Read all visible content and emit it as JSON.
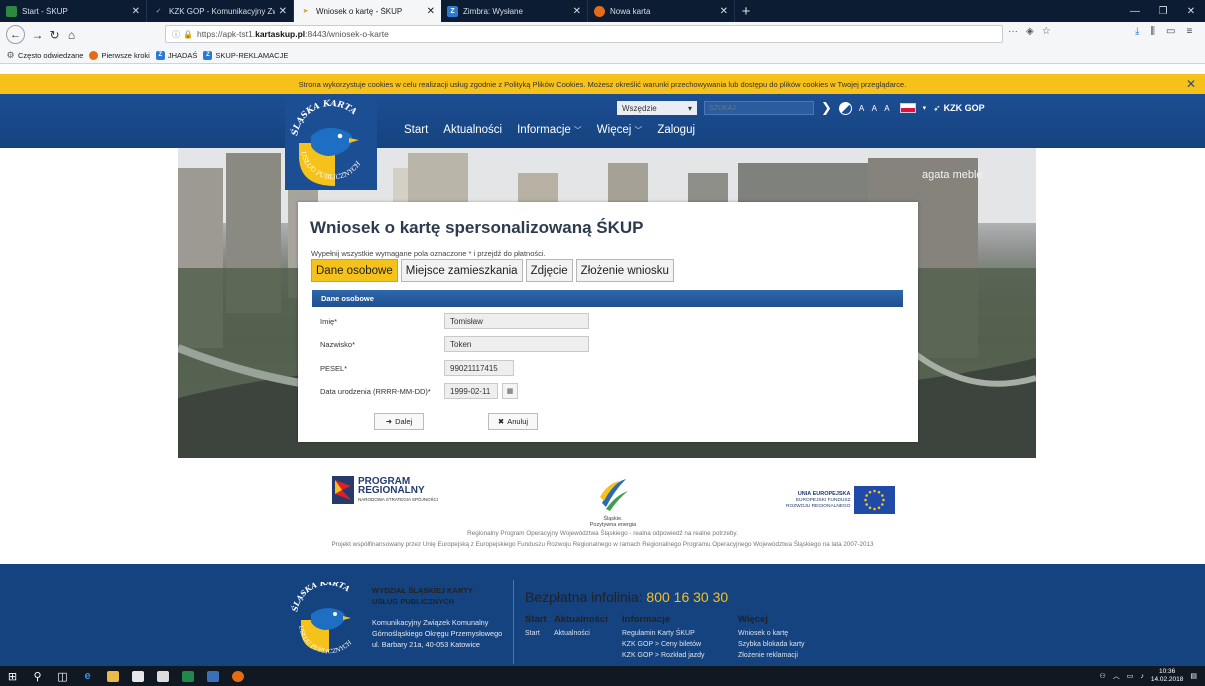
{
  "browser": {
    "tabs": [
      {
        "title": "Start - ŚKUP",
        "active": false
      },
      {
        "title": "KZK GOP - Komunikacyjny Zwi",
        "active": false
      },
      {
        "title": "Wniosek o kartę - ŚKUP",
        "active": true
      },
      {
        "title": "Zimbra: Wysłane",
        "active": false
      },
      {
        "title": "Nowa karta",
        "active": false
      }
    ],
    "url_prefix": "https://apk-tst1.",
    "url_host": "kartaskup.pl",
    "url_suffix": ":8443/wniosek-o-karte",
    "bookmarks": [
      "Często odwiedzane",
      "Pierwsze kroki",
      "JHADAŚ",
      "SKUP-REKLAMACJE"
    ]
  },
  "cookie_bar": {
    "text": "Strona wykorzystuje cookies w celu realizacji usług zgodnie z Polityką Plików Cookies. Możesz określić warunki przechowywania lub dostępu do plików cookies w Twojej przeglądarce."
  },
  "header": {
    "logo_top": "ŚLĄSKA KARTA",
    "logo_bottom": "USŁUG PUBLICZNYCH",
    "nav": [
      {
        "label": "Start",
        "dropdown": false
      },
      {
        "label": "Aktualności",
        "dropdown": false
      },
      {
        "label": "Informacje",
        "dropdown": true
      },
      {
        "label": "Więcej",
        "dropdown": true
      },
      {
        "label": "Zaloguj",
        "dropdown": false
      }
    ],
    "search_scope": "Wszędzie",
    "search_placeholder": "SZUKAJ",
    "font_sizes": "A A A",
    "kzk_label": "KZK GOP"
  },
  "hero": {
    "sign_text": "agata meble"
  },
  "form": {
    "title": "Wniosek o kartę spersonalizowaną ŚKUP",
    "hint": "Wypełnij wszystkie wymagane pola oznaczone * i przejdź do płatności.",
    "tabs": [
      {
        "label": "Dane osobowe",
        "active": true
      },
      {
        "label": "Miejsce zamieszkania",
        "active": false
      },
      {
        "label": "Zdjęcie",
        "active": false
      },
      {
        "label": "Złożenie wniosku",
        "active": false
      }
    ],
    "section_title": "Dane osobowe",
    "fields": {
      "first_name": {
        "label": "Imię*",
        "value": "Tomisław"
      },
      "last_name": {
        "label": "Nazwisko*",
        "value": "Token"
      },
      "pesel": {
        "label": "PESEL*",
        "value": "99021117415"
      },
      "birth_date": {
        "label": "Data urodzenia (RRRR-MM-DD)*",
        "value": "1999-02-11"
      }
    },
    "next_label": "Dalej",
    "cancel_label": "Anuluj"
  },
  "sponsors": {
    "program_line1": "PROGRAM",
    "program_line2": "REGIONALNY",
    "program_sub": "NARODOWA STRATEGIA SPÓJNOŚCI",
    "slaskie_line1": "Śląskie.",
    "slaskie_line2": "Pozytywna energia",
    "eu_line1": "UNIA EUROPEJSKA",
    "eu_line2": "EUROPEJSKI FUNDUSZ",
    "eu_line3": "ROZWOJU REGIONALNEGO",
    "line1": "Regionalny Program Operacyjny Województwa Śląskiego - realna odpowiedź na realne potrzeby.",
    "line2": "Projekt współfinansowany przez Unię Europejską z Europejskiego Funduszu Rozwoju Regionalnego w ramach Regionalnego Programu Operacyjnego Województwa Śląskiego na lata 2007-2013"
  },
  "footer": {
    "org_line1": "WYDZIAŁ ŚLĄSKIEJ KARTY",
    "org_line2": "USŁUG PUBLICZNYCH",
    "addr_line1": "Komunikacyjny Związek Komunalny",
    "addr_line2": "Górnośląskiego Okręgu Przemysłowego",
    "addr_line3": "ul. Barbary 21a, 40-053 Katowice",
    "infoline_label": "Bezpłatna infolinia:",
    "infoline_number": "800 16 30 30",
    "cols": [
      {
        "title": "Start",
        "links": [
          "Start"
        ]
      },
      {
        "title": "Aktualności",
        "links": [
          "Aktualności"
        ]
      },
      {
        "title": "Informacje",
        "links": [
          "Regulamin Karty ŚKUP",
          "KZK GOP > Ceny biletów",
          "KZK GOP > Rozkład jazdy"
        ]
      },
      {
        "title": "Więcej",
        "links": [
          "Wniosek o kartę",
          "Szybka blokada karty",
          "Złożenie reklamacji"
        ]
      }
    ]
  },
  "taskbar": {
    "time": "10:36",
    "date": "14.02.2018"
  },
  "colors": {
    "header_blue": "#1c4e93",
    "accent_yellow": "#f5c21b",
    "cookie_yellow": "#f6c11a"
  }
}
